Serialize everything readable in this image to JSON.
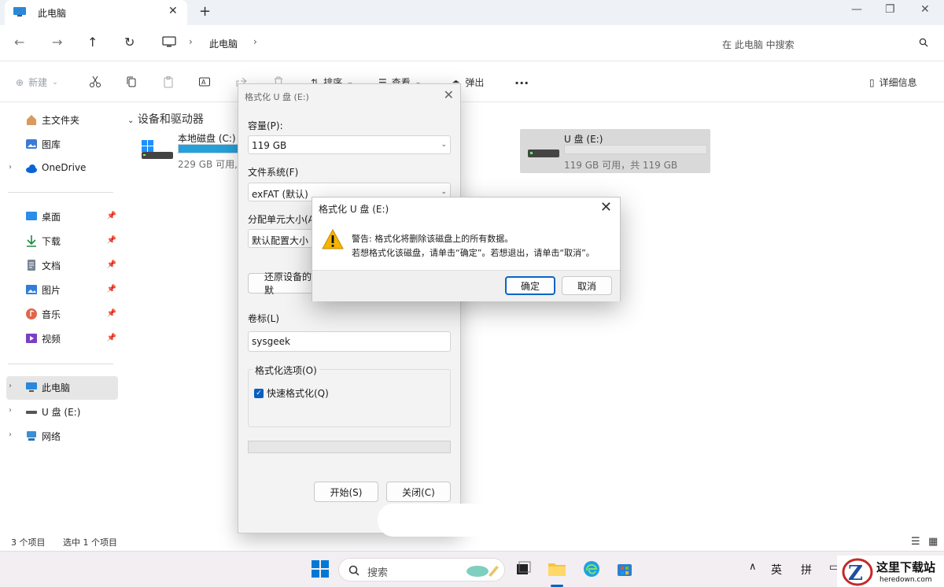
{
  "window": {
    "tab_title": "此电脑",
    "new_tab": "+"
  },
  "address": {
    "crumb": "此电脑",
    "search_placeholder": "在 此电脑 中搜索"
  },
  "commandbar": {
    "new_label": "新建",
    "sort_label": "排序",
    "view_label": "查看",
    "eject_label": "弹出",
    "more_label": "···",
    "details_label": "详细信息"
  },
  "sidebar": {
    "items": [
      {
        "label": "主文件夹"
      },
      {
        "label": "图库"
      },
      {
        "label": "OneDrive"
      },
      {
        "label": "桌面"
      },
      {
        "label": "下载"
      },
      {
        "label": "文档"
      },
      {
        "label": "图片"
      },
      {
        "label": "音乐"
      },
      {
        "label": "视频"
      },
      {
        "label": "此电脑"
      },
      {
        "label": "U 盘 (E:)"
      },
      {
        "label": "网络"
      }
    ]
  },
  "main": {
    "group_title": "设备和驱动器",
    "drives": [
      {
        "name": "本地磁盘 (C:)",
        "space": "229 GB 可用,",
        "used_fraction": 0.45,
        "accent": "#26a0da"
      },
      {
        "name": "U 盘 (E:)",
        "space": "119 GB 可用，共 119 GB",
        "used_fraction": 0.0
      }
    ]
  },
  "status": {
    "count": "3 个项目",
    "selection": "选中 1 个项目"
  },
  "format_dialog": {
    "title": "格式化 U 盘 (E:)",
    "capacity_label": "容量(P):",
    "capacity_value": "119 GB",
    "fs_label": "文件系统(F)",
    "fs_value": "exFAT (默认)",
    "alloc_label": "分配单元大小(A",
    "alloc_value": "默认配置大小",
    "restore_label": "还原设备的默",
    "volume_label": "卷标(L)",
    "volume_value": "sysgeek",
    "options_label": "格式化选项(O)",
    "quick_label": "快速格式化(Q)",
    "start_label": "开始(S)",
    "close_label": "关闭(C)"
  },
  "warning_dialog": {
    "title": "格式化 U 盘 (E:)",
    "line1": "警告: 格式化将删除该磁盘上的所有数据。",
    "line2": "若想格式化该磁盘，请单击“确定”。若想退出，请单击“取消”。",
    "ok_label": "确定",
    "cancel_label": "取消"
  },
  "taskbar": {
    "search_label": "搜索",
    "ime_lang": "英",
    "ime_mode": "拼"
  },
  "watermark": {
    "title": "这里下载站",
    "url": "heredown.com"
  }
}
